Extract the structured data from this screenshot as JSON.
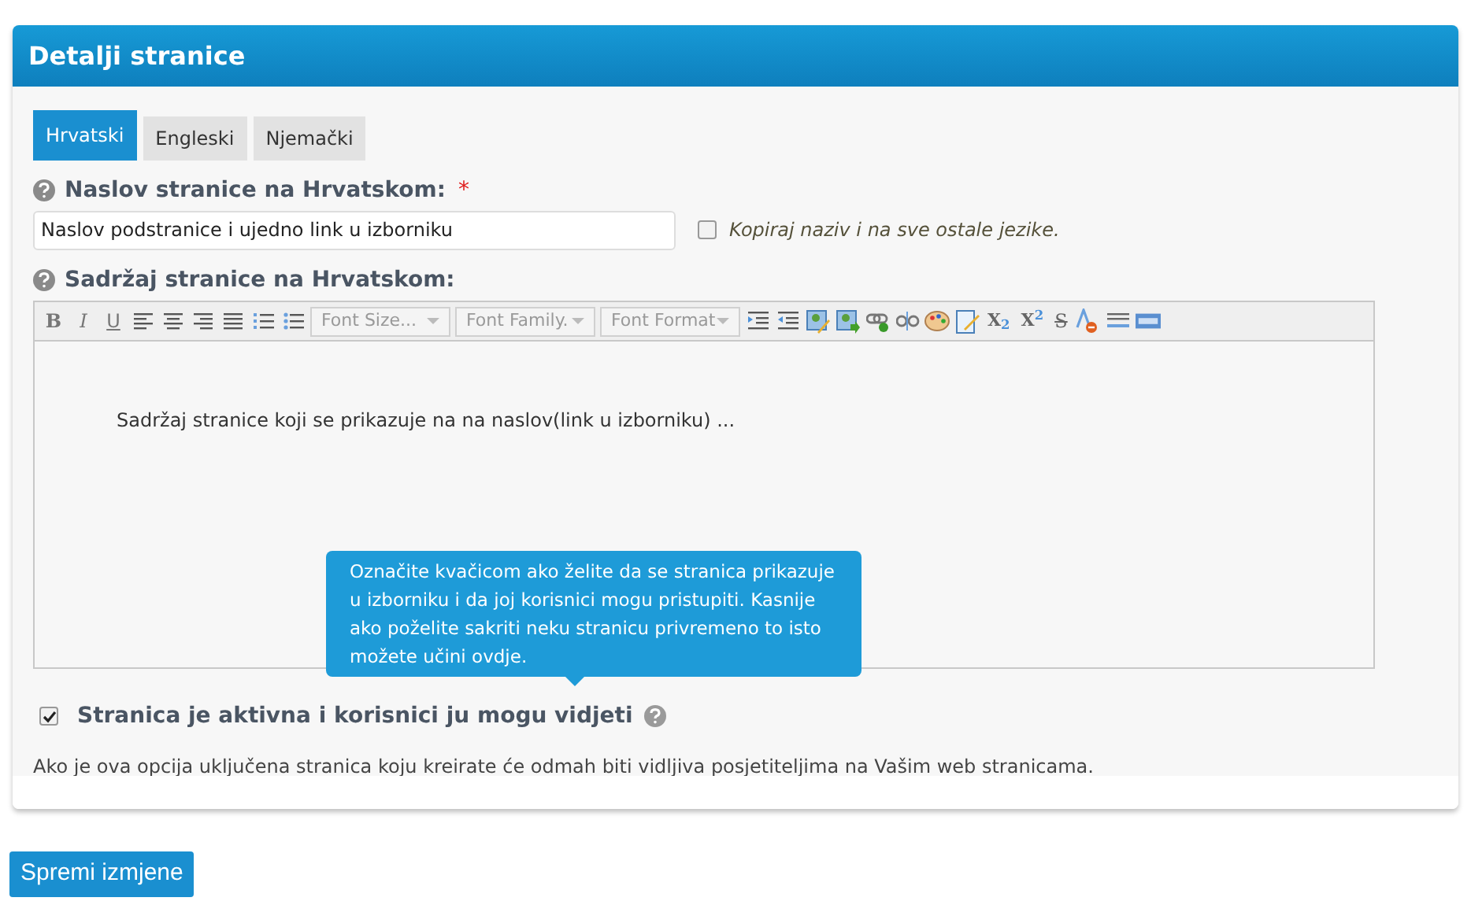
{
  "panel": {
    "title": "Detalji stranice"
  },
  "tabs": [
    {
      "label": "Hrvatski",
      "selected": true
    },
    {
      "label": "Engleski",
      "selected": false
    },
    {
      "label": "Njemački",
      "selected": false
    }
  ],
  "title_field": {
    "label": "Naslov stranice na Hrvatskom:",
    "required_mark": "*",
    "value": "Naslov podstranice i ujedno link u izborniku"
  },
  "copy_option": {
    "label": "Kopiraj naziv i na sve ostale jezike.",
    "checked": false
  },
  "content_field": {
    "label": "Sadržaj stranice na Hrvatskom:",
    "toolbar": {
      "format_buttons": [
        "B",
        "I",
        "U"
      ],
      "selects": [
        "Font Size...",
        "Font Family.",
        "Font Format"
      ],
      "script_buttons": [
        "X$_{2}$",
        "X$^{2}$"
      ],
      "strike_button": "S"
    },
    "content": "Sadržaj stranice koji se prikazuje na na naslov(link u izborniku) ..."
  },
  "tooltip": "Označite kvačicom ako želite da se stranica prikazuje u izborniku i da joj korisnici mogu pristupiti. Kasnije ako poželite sakriti neku stranicu privremeno to isto možete učini ovdje.",
  "active_option": {
    "label": "Stranica je aktivna i korisnici ju mogu vidjeti",
    "checked": true
  },
  "note": "Ako je ova opcija uključena stranica koju kreirate će odmah biti vidljiva posjetiteljima na Vašim web stranicama.",
  "save_button": "Spremi izmjene"
}
